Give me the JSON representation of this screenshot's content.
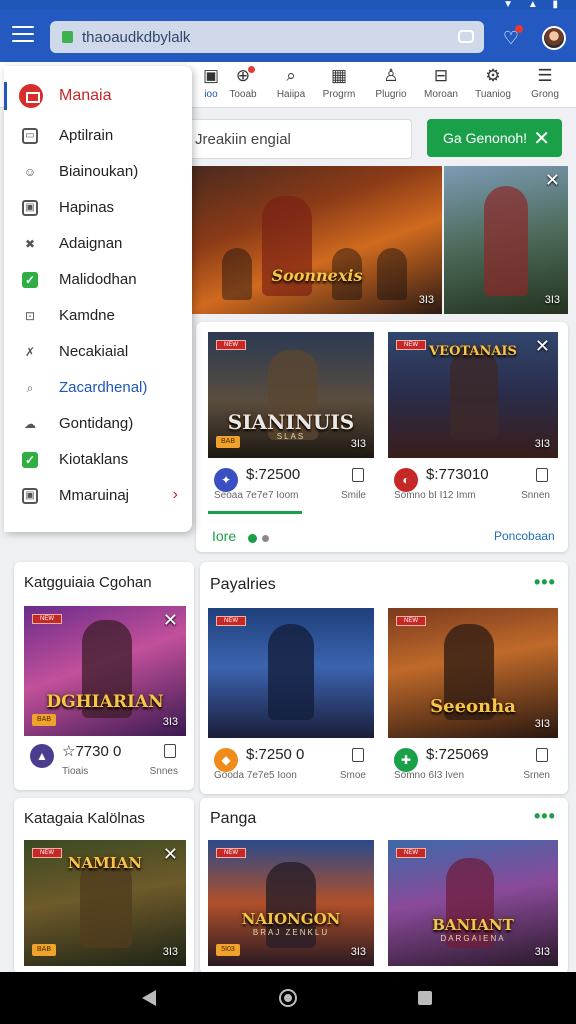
{
  "browser": {
    "url": "thaoaudkdbylalk"
  },
  "top_nav": [
    {
      "label": "ioo",
      "icon": "store-icon",
      "glyph": "▣"
    },
    {
      "label": "Tooab",
      "icon": "gamepad-icon",
      "glyph": "⊕"
    },
    {
      "label": "Haiipa",
      "icon": "search-icon",
      "glyph": "⌕"
    },
    {
      "label": "Progrm",
      "icon": "grid-icon",
      "glyph": "▦"
    },
    {
      "label": "Plugrio",
      "icon": "profile-icon",
      "glyph": "♙"
    },
    {
      "label": "Moroan",
      "icon": "window-icon",
      "glyph": "⊟"
    },
    {
      "label": "Tuaniog",
      "icon": "gear-icon",
      "glyph": "⚙"
    },
    {
      "label": "Grong",
      "icon": "menu-icon",
      "glyph": "☰"
    }
  ],
  "drawer": {
    "header": "Manaia",
    "items": [
      {
        "label": "Aptilrain",
        "icon": "monitor-icon",
        "glyph": "▭",
        "style": "box"
      },
      {
        "label": "Biainoukan)",
        "icon": "user-icon",
        "glyph": "☺",
        "style": "plain"
      },
      {
        "label": "Hapinas",
        "icon": "image-icon",
        "glyph": "▣",
        "style": "box"
      },
      {
        "label": "Adaignan",
        "icon": "tools-icon",
        "glyph": "✖",
        "style": "plain"
      },
      {
        "label": "Malidodhan",
        "icon": "check-icon",
        "glyph": "✓",
        "style": "check"
      },
      {
        "label": "Kamdne",
        "icon": "lock-icon",
        "glyph": "⊡",
        "style": "plain"
      },
      {
        "label": "Necakiaial",
        "icon": "sword-icon",
        "glyph": "✗",
        "style": "plain"
      },
      {
        "label": "Zacardhenal)",
        "icon": "search-icon",
        "glyph": "⌕",
        "style": "plain",
        "highlight": true
      },
      {
        "label": "Gontidang)",
        "icon": "cloud-icon",
        "glyph": "☁",
        "style": "plain"
      },
      {
        "label": "Kiotaklans",
        "icon": "check-icon",
        "glyph": "✓",
        "style": "check"
      },
      {
        "label": "Mmaruinaj",
        "icon": "window-icon",
        "glyph": "▣",
        "style": "box",
        "arrow": true
      }
    ],
    "arrow_glyph": "›"
  },
  "search": {
    "text": "Jreakiin engial",
    "button": "Ga Genonoh!",
    "close_glyph": "✕"
  },
  "banner": {
    "title": "Soonnexis",
    "rating_left": "3I3",
    "rating_right": "3I3",
    "close_glyph": "✕"
  },
  "featured": {
    "cards": [
      {
        "title": "SIANINUIS",
        "subtitle": "SLAS",
        "rating": "3I3",
        "badge": "BAB",
        "price": "$:72500",
        "sub": "Seoaa  7e7e7 Ioom",
        "save": "Smile",
        "icon_color": "#3b4fc4",
        "icon_glyph": "✦"
      },
      {
        "title": "VEOTANAIS",
        "subtitle": "",
        "rating": "3I3",
        "badge": "",
        "price": "$:773010",
        "sub": "Somno  bI I12 Imm",
        "save": "Snnen",
        "icon_color": "#c62828",
        "icon_glyph": "◐"
      }
    ],
    "link_left": "Iore",
    "link_right": "Poncobaan"
  },
  "section_left_1": {
    "title": "Katgguiaia Cgohan",
    "card": {
      "title": "DGHIARIAN",
      "rating": "3I3",
      "badge": "BAB",
      "price": "☆7730 0",
      "sub": "Tioais",
      "save": "Snnes",
      "icon_color": "#4b3c8f",
      "icon_glyph": "▲"
    }
  },
  "section_right_1": {
    "title": "Payalries",
    "more": "•••",
    "cards": [
      {
        "title": "",
        "rating": "",
        "price": "$:7250 0",
        "sub": "Gooda  7e7e5 Ioon",
        "save": "Smoe",
        "icon_color": "#f08a1a",
        "icon_glyph": "◆"
      },
      {
        "title": "Seeonha",
        "rating": "3I3",
        "price": "$:725069",
        "sub": "Somno  6I3 Iven",
        "save": "Srnen",
        "icon_color": "#1ba04a",
        "icon_glyph": "✚"
      }
    ]
  },
  "section_left_2": {
    "title": "Katagaia Kalölnas",
    "card": {
      "title": "NAMIAN",
      "rating": "3I3",
      "badge": "BAB"
    }
  },
  "section_right_2": {
    "title": "Panga",
    "more": "•••",
    "cards": [
      {
        "title": "NAIONGON",
        "subtitle": "BRAJ ZENKLU",
        "rating": "3I3",
        "badge": "5I03"
      },
      {
        "title": "BANIANT",
        "subtitle": "DARGAIENA",
        "rating": "3I3",
        "badge": ""
      }
    ]
  },
  "tag_label": "NEW",
  "status_icons": "▼ ▲ ▮"
}
